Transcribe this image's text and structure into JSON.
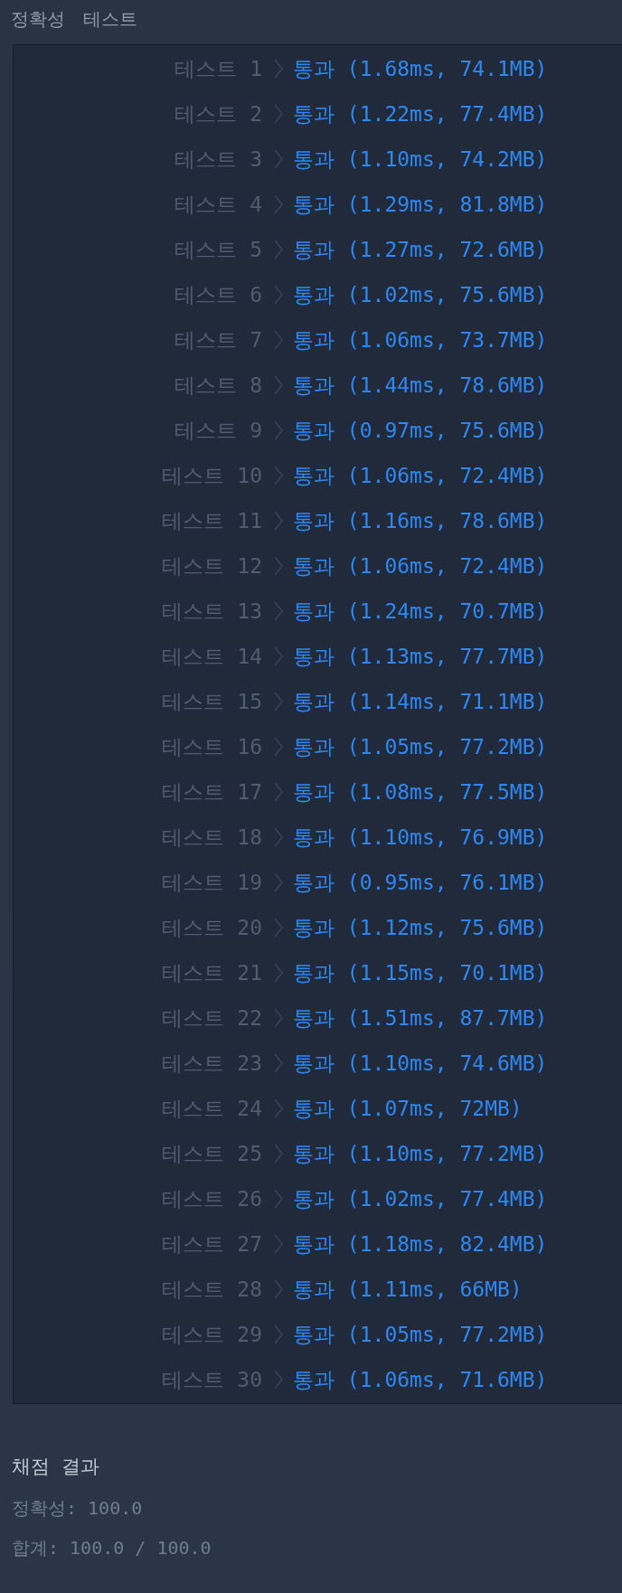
{
  "section_title": "정확성 테스트",
  "tests": [
    {
      "label": "테스트 1",
      "result": "통과 (1.68ms, 74.1MB)"
    },
    {
      "label": "테스트 2",
      "result": "통과 (1.22ms, 77.4MB)"
    },
    {
      "label": "테스트 3",
      "result": "통과 (1.10ms, 74.2MB)"
    },
    {
      "label": "테스트 4",
      "result": "통과 (1.29ms, 81.8MB)"
    },
    {
      "label": "테스트 5",
      "result": "통과 (1.27ms, 72.6MB)"
    },
    {
      "label": "테스트 6",
      "result": "통과 (1.02ms, 75.6MB)"
    },
    {
      "label": "테스트 7",
      "result": "통과 (1.06ms, 73.7MB)"
    },
    {
      "label": "테스트 8",
      "result": "통과 (1.44ms, 78.6MB)"
    },
    {
      "label": "테스트 9",
      "result": "통과 (0.97ms, 75.6MB)"
    },
    {
      "label": "테스트 10",
      "result": "통과 (1.06ms, 72.4MB)"
    },
    {
      "label": "테스트 11",
      "result": "통과 (1.16ms, 78.6MB)"
    },
    {
      "label": "테스트 12",
      "result": "통과 (1.06ms, 72.4MB)"
    },
    {
      "label": "테스트 13",
      "result": "통과 (1.24ms, 70.7MB)"
    },
    {
      "label": "테스트 14",
      "result": "통과 (1.13ms, 77.7MB)"
    },
    {
      "label": "테스트 15",
      "result": "통과 (1.14ms, 71.1MB)"
    },
    {
      "label": "테스트 16",
      "result": "통과 (1.05ms, 77.2MB)"
    },
    {
      "label": "테스트 17",
      "result": "통과 (1.08ms, 77.5MB)"
    },
    {
      "label": "테스트 18",
      "result": "통과 (1.10ms, 76.9MB)"
    },
    {
      "label": "테스트 19",
      "result": "통과 (0.95ms, 76.1MB)"
    },
    {
      "label": "테스트 20",
      "result": "통과 (1.12ms, 75.6MB)"
    },
    {
      "label": "테스트 21",
      "result": "통과 (1.15ms, 70.1MB)"
    },
    {
      "label": "테스트 22",
      "result": "통과 (1.51ms, 87.7MB)"
    },
    {
      "label": "테스트 23",
      "result": "통과 (1.10ms, 74.6MB)"
    },
    {
      "label": "테스트 24",
      "result": "통과 (1.07ms, 72MB)"
    },
    {
      "label": "테스트 25",
      "result": "통과 (1.10ms, 77.2MB)"
    },
    {
      "label": "테스트 26",
      "result": "통과 (1.02ms, 77.4MB)"
    },
    {
      "label": "테스트 27",
      "result": "통과 (1.18ms, 82.4MB)"
    },
    {
      "label": "테스트 28",
      "result": "통과 (1.11ms, 66MB)"
    },
    {
      "label": "테스트 29",
      "result": "통과 (1.05ms, 77.2MB)"
    },
    {
      "label": "테스트 30",
      "result": "통과 (1.06ms, 71.6MB)"
    }
  ],
  "summary": {
    "title": "채점 결과",
    "lines": [
      "정확성: 100.0",
      "합계: 100.0 / 100.0"
    ]
  }
}
